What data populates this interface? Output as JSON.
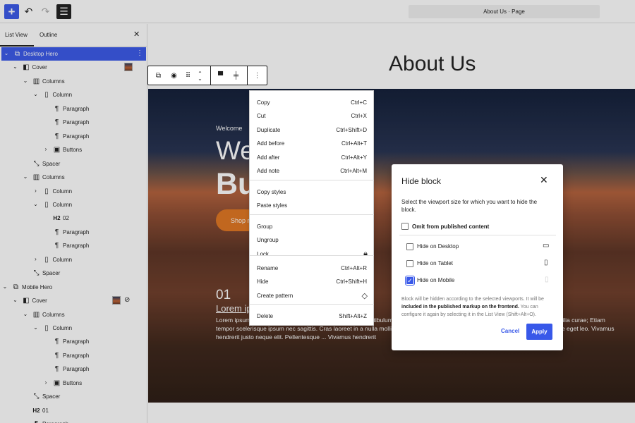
{
  "topbar": {
    "add_icon": "plus-icon",
    "undo_icon": "undo-icon",
    "redo_icon": "redo-icon",
    "listview_icon": "list-view-icon",
    "document_title": "About Us · Page"
  },
  "sidebar": {
    "tabs": [
      "List View",
      "Outline"
    ],
    "close_icon": "close-icon",
    "tree": [
      {
        "label": "Desktop Hero",
        "level": 0,
        "chevron": "open",
        "icon": "group-icon",
        "selected": true,
        "extra": "options-icon"
      },
      {
        "label": "Cover",
        "level": 1,
        "chevron": "open",
        "icon": "cover-icon",
        "extra": "thumbnail"
      },
      {
        "label": "Columns",
        "level": 2,
        "chevron": "open",
        "icon": "columns-icon"
      },
      {
        "label": "Column",
        "level": 3,
        "chevron": "open",
        "icon": "column-icon"
      },
      {
        "label": "Paragraph",
        "level": 4,
        "icon": "paragraph-icon"
      },
      {
        "label": "Paragraph",
        "level": 4,
        "icon": "paragraph-icon"
      },
      {
        "label": "Paragraph",
        "level": 4,
        "icon": "paragraph-icon"
      },
      {
        "label": "Buttons",
        "level": 4,
        "chevron": "closed",
        "icon": "buttons-icon"
      },
      {
        "label": "Spacer",
        "level": 2,
        "icon": "spacer-icon"
      },
      {
        "label": "Columns",
        "level": 2,
        "chevron": "open",
        "icon": "columns-icon"
      },
      {
        "label": "Column",
        "level": 3,
        "chevron": "closed",
        "icon": "column-icon"
      },
      {
        "label": "Column",
        "level": 3,
        "chevron": "open",
        "icon": "column-icon"
      },
      {
        "label": "02",
        "level": 4,
        "icon": "heading-icon",
        "badge": "H2"
      },
      {
        "label": "Paragraph",
        "level": 4,
        "icon": "paragraph-icon"
      },
      {
        "label": "Paragraph",
        "level": 4,
        "icon": "paragraph-icon"
      },
      {
        "label": "Column",
        "level": 3,
        "chevron": "closed",
        "icon": "column-icon"
      },
      {
        "label": "Spacer",
        "level": 2,
        "icon": "spacer-icon"
      },
      {
        "label": "Mobile Hero",
        "level": 0,
        "chevron": "open",
        "icon": "group-icon"
      },
      {
        "label": "Cover",
        "level": 1,
        "chevron": "open",
        "icon": "cover-icon",
        "extra": "thumbnail-hidden"
      },
      {
        "label": "Columns",
        "level": 2,
        "chevron": "open",
        "icon": "columns-icon"
      },
      {
        "label": "Column",
        "level": 3,
        "chevron": "open",
        "icon": "column-icon"
      },
      {
        "label": "Paragraph",
        "level": 4,
        "icon": "paragraph-icon"
      },
      {
        "label": "Paragraph",
        "level": 4,
        "icon": "paragraph-icon"
      },
      {
        "label": "Paragraph",
        "level": 4,
        "icon": "paragraph-icon"
      },
      {
        "label": "Buttons",
        "level": 4,
        "chevron": "closed",
        "icon": "buttons-icon"
      },
      {
        "label": "Spacer",
        "level": 2,
        "icon": "spacer-icon"
      },
      {
        "label": "01",
        "level": 2,
        "icon": "heading-icon",
        "badge": "H2"
      },
      {
        "label": "Paragraph",
        "level": 2,
        "icon": "paragraph-icon"
      }
    ]
  },
  "canvas": {
    "page_title": "About Us",
    "cover": {
      "welcome": "Welcome",
      "headline_1": "We          ur",
      "headline_2": "Bu",
      "button": "Shop n",
      "number": "01",
      "subhead": "Lorem ip",
      "body": "Lorem ipsum dolor sit amet, consectetur adipiscing elit. Vestibulum ante ipsum primis in faucibus orci luctus et ultrices posuere cubilia curae; Etiam tempor scelerisque ipsum nec sagittis. Cras laoreet in a nulla mollis fringilla. Sed bibendum ullamcorper du nunc, et interdum augue eget leo. Vivamus hendrerit justo neque                          elit. Pellentesque                          ... Vivamus hendrerit"
    }
  },
  "block_toolbar": {
    "icons": [
      "parent-block-icon",
      "visibility-icon",
      "drag-handle-icon",
      "move-arrows-icon",
      "align-icon",
      "justify-icon",
      "more-options-icon"
    ]
  },
  "context_menu": {
    "items": [
      {
        "label": "Copy",
        "shortcut": "Ctrl+C"
      },
      {
        "label": "Cut",
        "shortcut": "Ctrl+X"
      },
      {
        "label": "Duplicate",
        "shortcut": "Ctrl+Shift+D"
      },
      {
        "label": "Add before",
        "shortcut": "Ctrl+Alt+T"
      },
      {
        "label": "Add after",
        "shortcut": "Ctrl+Alt+Y"
      },
      {
        "label": "Add note",
        "shortcut": "Ctrl+Alt+M"
      },
      {
        "label": "Copy styles",
        "shortcut": ""
      },
      {
        "label": "Paste styles",
        "shortcut": ""
      },
      {
        "label": "Group",
        "shortcut": ""
      },
      {
        "label": "Ungroup",
        "shortcut": ""
      },
      {
        "label": "Lock",
        "shortcut": "",
        "icon": "lock-icon"
      },
      {
        "label": "Rename",
        "shortcut": "Ctrl+Alt+R"
      },
      {
        "label": "Hide",
        "shortcut": "Ctrl+Shift+H"
      },
      {
        "label": "Create pattern",
        "shortcut": "",
        "icon": "pattern-icon"
      },
      {
        "label": "Delete",
        "shortcut": "Shift+Alt+Z"
      }
    ]
  },
  "modal": {
    "title": "Hide block",
    "description": "Select the viewport size for which you want to hide the block.",
    "omit_label": "Omit from published content",
    "omit_checked": false,
    "viewports": [
      {
        "label": "Hide on Desktop",
        "checked": false,
        "icon": "desktop-icon"
      },
      {
        "label": "Hide on Tablet",
        "checked": false,
        "icon": "tablet-icon"
      },
      {
        "label": "Hide on Mobile",
        "checked": true,
        "icon": "mobile-icon"
      }
    ],
    "note_1": "Block will be hidden according to the selected viewports. It will be",
    "note_bold": "included in the published markup on the frontend.",
    "note_2": " You can configure it again by selecting it in the List View (Shift+Alt+O).",
    "cancel": "Cancel",
    "apply": "Apply"
  },
  "colors": {
    "accent": "#3858e9",
    "cta": "#e0751f"
  }
}
